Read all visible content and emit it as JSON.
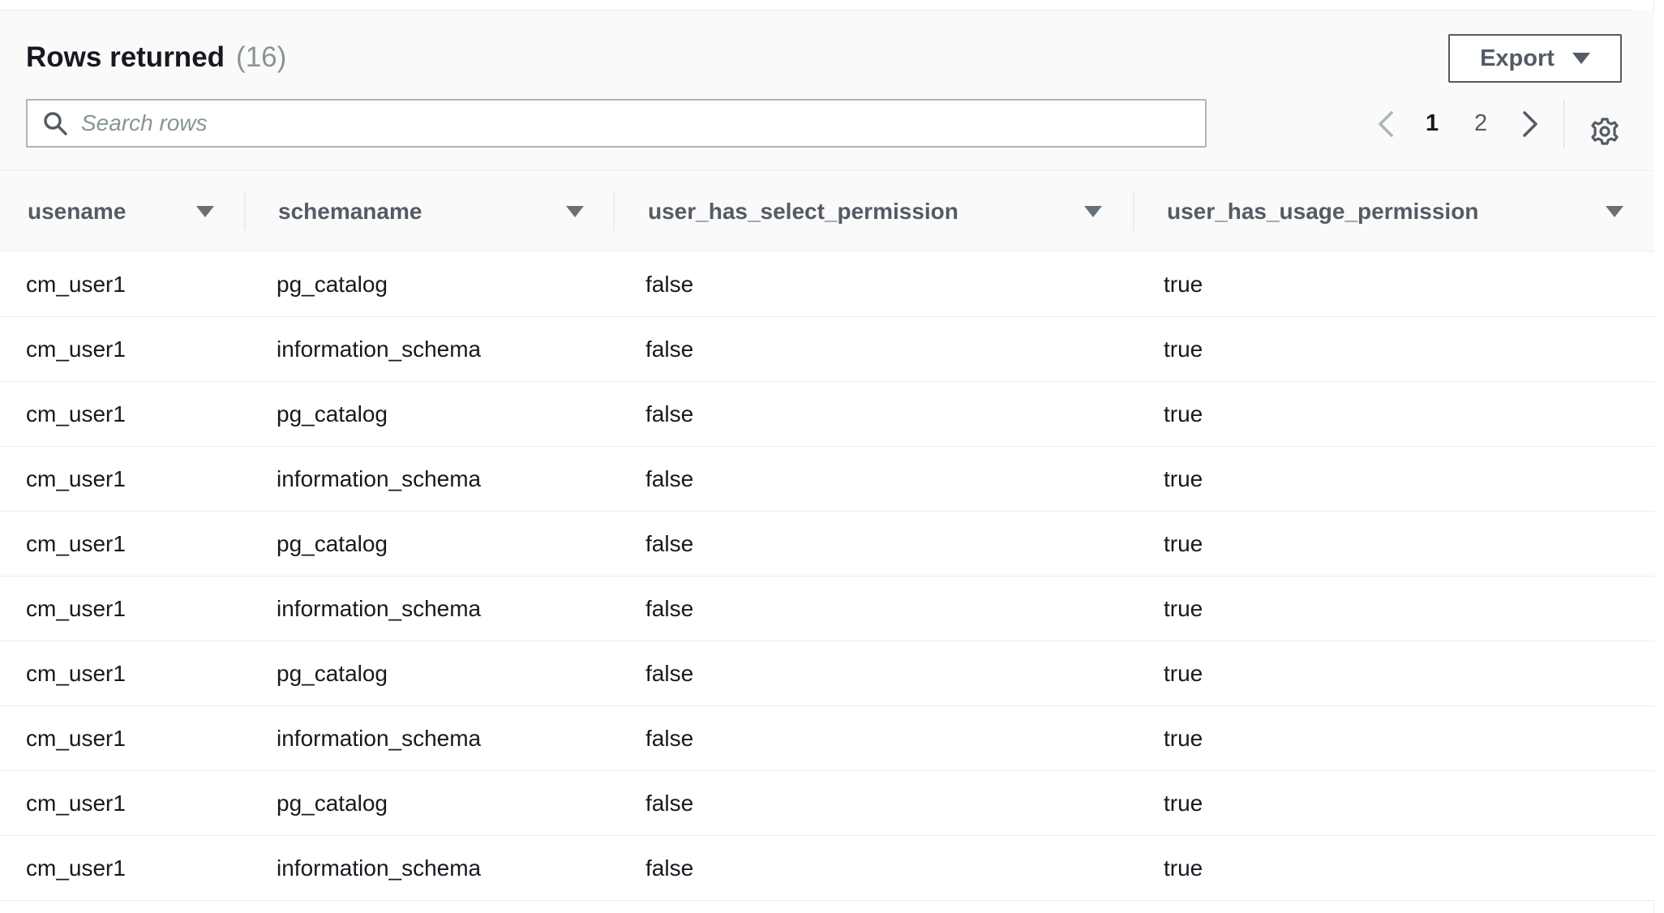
{
  "header": {
    "title": "Rows returned",
    "count": "(16)",
    "export_label": "Export"
  },
  "search": {
    "placeholder": "Search rows",
    "value": ""
  },
  "pagination": {
    "pages": [
      "1",
      "2"
    ],
    "current": "1"
  },
  "icons": {
    "search": "search-icon",
    "prev": "chevron-left-icon",
    "next": "chevron-right-icon",
    "settings": "gear-icon",
    "sort": "caret-down-icon"
  },
  "colors": {
    "text": "#16191f",
    "muted": "#879596",
    "header_bg": "#fafafa",
    "border": "#eaeded"
  },
  "table": {
    "columns": [
      "usename",
      "schemaname",
      "user_has_select_permission",
      "user_has_usage_permission"
    ],
    "rows": [
      [
        "cm_user1",
        "pg_catalog",
        "false",
        "true"
      ],
      [
        "cm_user1",
        "information_schema",
        "false",
        "true"
      ],
      [
        "cm_user1",
        "pg_catalog",
        "false",
        "true"
      ],
      [
        "cm_user1",
        "information_schema",
        "false",
        "true"
      ],
      [
        "cm_user1",
        "pg_catalog",
        "false",
        "true"
      ],
      [
        "cm_user1",
        "information_schema",
        "false",
        "true"
      ],
      [
        "cm_user1",
        "pg_catalog",
        "false",
        "true"
      ],
      [
        "cm_user1",
        "information_schema",
        "false",
        "true"
      ],
      [
        "cm_user1",
        "pg_catalog",
        "false",
        "true"
      ],
      [
        "cm_user1",
        "information_schema",
        "false",
        "true"
      ]
    ]
  }
}
